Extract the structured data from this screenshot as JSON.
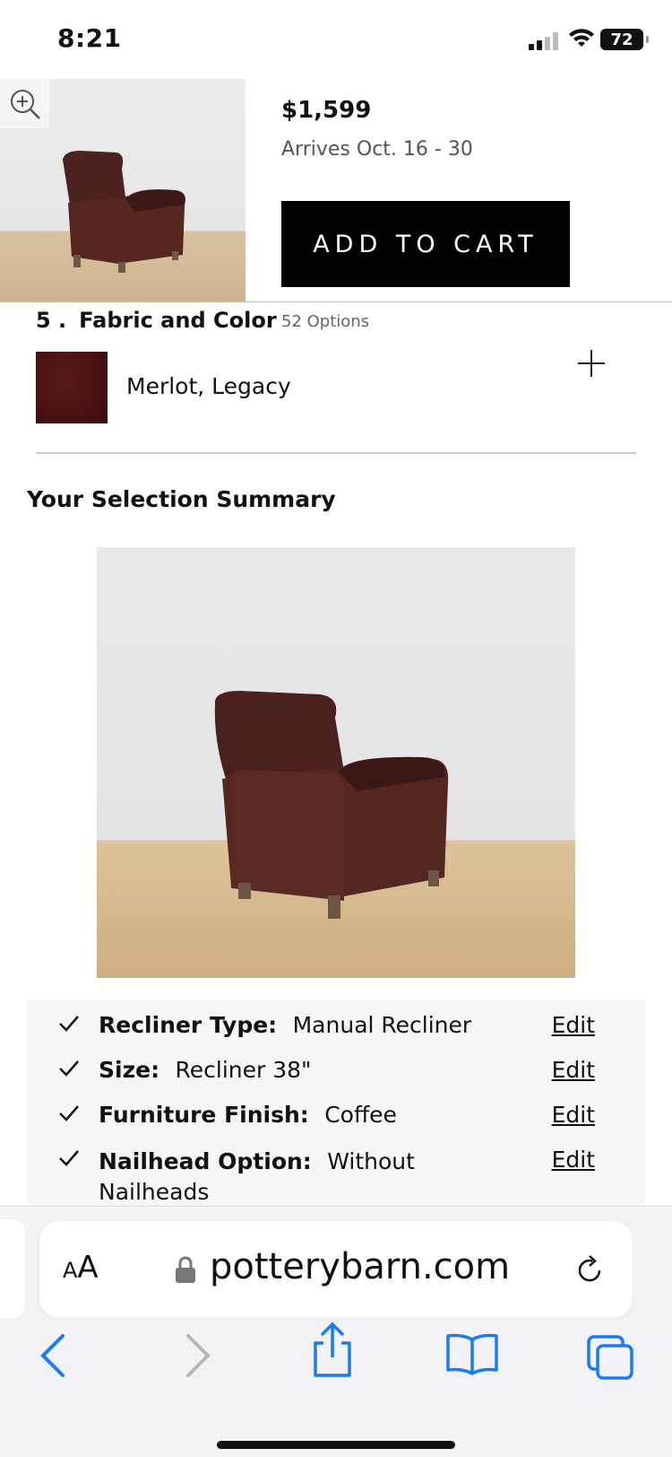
{
  "status_bar": {
    "time": "8:21",
    "battery": "72"
  },
  "product_bar": {
    "price": "$1,599",
    "arrives": "Arrives Oct. 16 - 30",
    "add_to_cart": "ADD TO CART"
  },
  "fabric": {
    "number": "5 .",
    "title": "Fabric and Color",
    "options": "52 Options",
    "selected": "Merlot, Legacy",
    "swatch_color": "#4a1416"
  },
  "summary": {
    "title": "Your Selection Summary",
    "rows": [
      {
        "key": "Recliner Type:",
        "value": "Manual Recliner",
        "edit": "Edit"
      },
      {
        "key": "Size:",
        "value": "Recliner 38\"",
        "edit": "Edit"
      },
      {
        "key": "Furniture Finish:",
        "value": "Coffee",
        "edit": "Edit"
      },
      {
        "key": "Nailhead Option:",
        "value": "Without Nailheads",
        "edit": "Edit"
      }
    ]
  },
  "browser": {
    "aa_label_small": "A",
    "aa_label_large": "A",
    "url": "potterybarn.com",
    "accent": "#1a7cf0"
  }
}
